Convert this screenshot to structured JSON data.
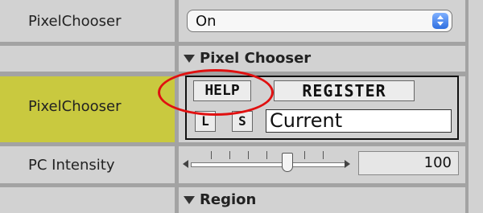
{
  "rows": {
    "pixelchooser_top": {
      "label": "PixelChooser",
      "select_value": "On"
    },
    "section_pixel_chooser": {
      "label": "Pixel Chooser"
    },
    "pixelchooser_main": {
      "label": "PixelChooser",
      "help_label": "HELP",
      "register_label": "REGISTER",
      "l_label": "L",
      "s_label": "S",
      "current_value": "Current"
    },
    "pc_intensity": {
      "label": "PC Intensity",
      "value": "100",
      "slider_fraction": 0.6
    },
    "section_region": {
      "label": "Region"
    }
  },
  "colors": {
    "highlight": "#c9c93f",
    "annotation_circle": "#e01010",
    "stepper_accent": "#2f6fe0"
  },
  "icons": {
    "select_stepper": "up-down-arrows-icon",
    "disclosure": "triangle-down-icon",
    "slider_left": "arrow-left-icon",
    "slider_right": "arrow-right-icon"
  }
}
